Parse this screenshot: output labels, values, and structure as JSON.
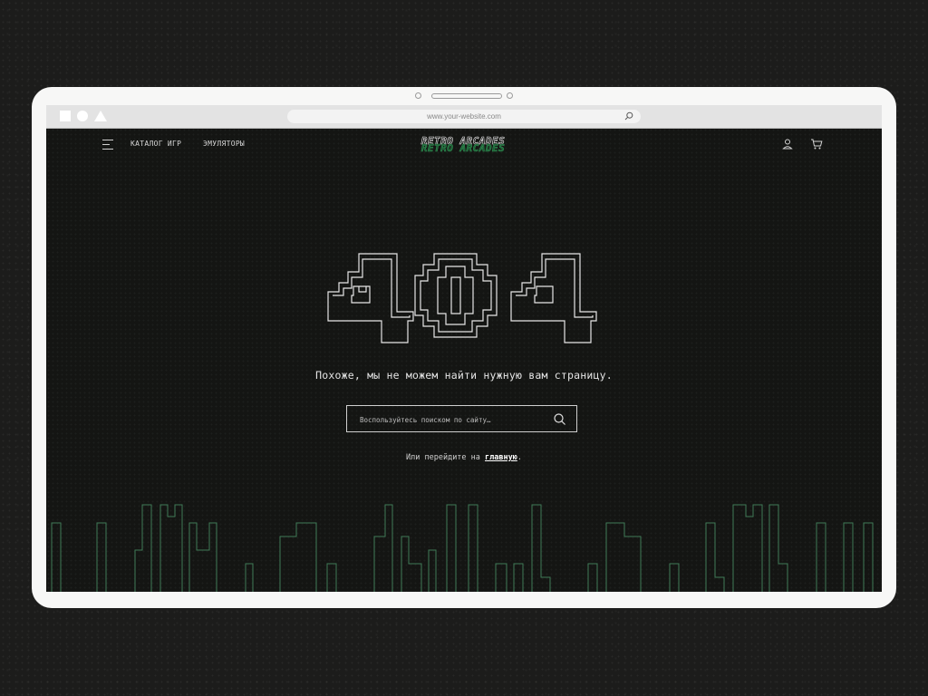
{
  "browser": {
    "url": "www.your-website.com"
  },
  "nav": {
    "menu_icon": "hamburger-icon",
    "links": [
      "КАТАЛОГ ИГР",
      "ЭМУЛЯТОРЫ"
    ],
    "logo_text": "RETRO ARCADES",
    "account_icon": "user-icon",
    "cart_icon": "cart-icon"
  },
  "error": {
    "code": "404",
    "message": "Похоже, мы не можем найти нужную вам страницу.",
    "search_placeholder": "Воспользуйтесь поиском по сайту…",
    "alt_prefix": "Или перейдите на ",
    "alt_link": "главную",
    "alt_suffix": "."
  },
  "colors": {
    "background": "#141513",
    "accent_green": "#2f8f52",
    "skyline_green": "#3f7a57",
    "text": "#e4e4e4"
  }
}
